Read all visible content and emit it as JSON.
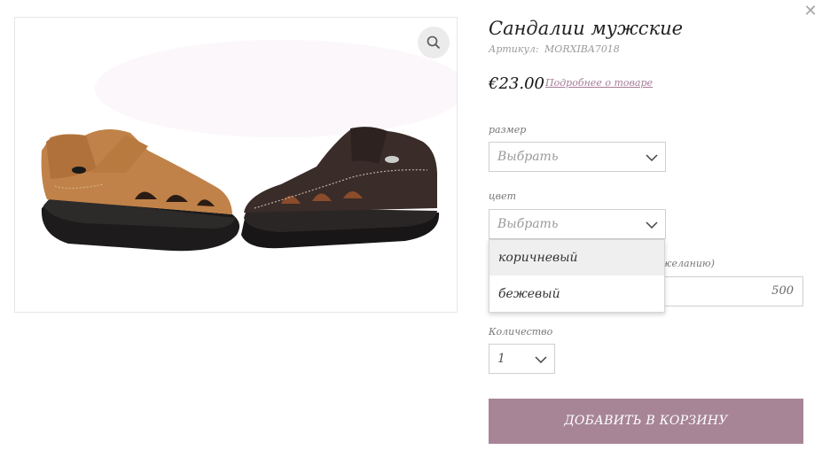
{
  "product": {
    "title": "Сандалии мужские",
    "sku_label": "Артикул:",
    "sku_value": "MORXIBA7018",
    "price": "€23.00",
    "details_link": "Подробнее о товаре"
  },
  "options": {
    "size": {
      "label": "размер",
      "value": "Выбрать"
    },
    "color": {
      "label": "цвет",
      "value": "Выбрать",
      "dropdown_items": [
        "коричневый",
        "бежевый"
      ],
      "highlighted_index": 0
    },
    "hidden_field": {
      "label_visible_fragment": "желанию)",
      "value": "500"
    },
    "quantity": {
      "label": "Количество",
      "value": "1"
    }
  },
  "buttons": {
    "add_to_cart": "ДОБАВИТЬ В КОРЗИНУ"
  },
  "colors": {
    "accent": "#a78596",
    "link": "#a67c98"
  },
  "icons": {
    "close": "close-icon",
    "zoom": "zoom-icon",
    "dropdown": "chevron-down-icon"
  }
}
